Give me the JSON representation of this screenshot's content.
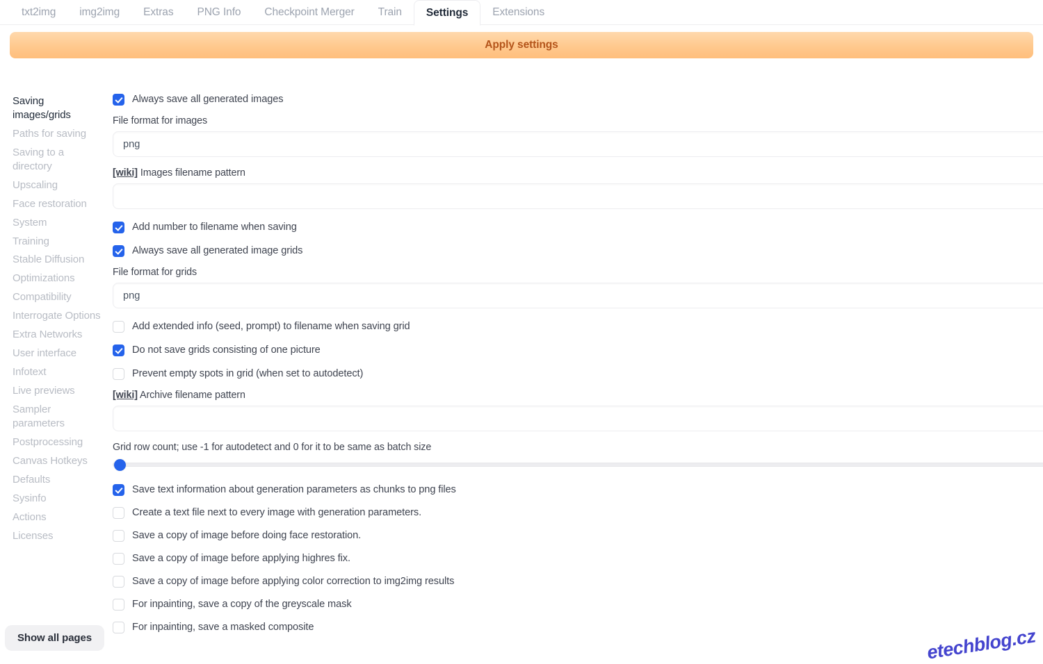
{
  "tabs": [
    {
      "label": "txt2img",
      "active": false
    },
    {
      "label": "img2img",
      "active": false
    },
    {
      "label": "Extras",
      "active": false
    },
    {
      "label": "PNG Info",
      "active": false
    },
    {
      "label": "Checkpoint Merger",
      "active": false
    },
    {
      "label": "Train",
      "active": false
    },
    {
      "label": "Settings",
      "active": true
    },
    {
      "label": "Extensions",
      "active": false
    }
  ],
  "toolbar": {
    "apply_label": "Apply settings",
    "apply_bg_start": "#ffd9ad",
    "apply_bg_end": "#ffbe7c",
    "apply_text_color": "#b4541a"
  },
  "sidebar": {
    "items": [
      {
        "label": "Saving images/grids",
        "active": true
      },
      {
        "label": "Paths for saving",
        "active": false
      },
      {
        "label": "Saving to a directory",
        "active": false
      },
      {
        "label": "Upscaling",
        "active": false
      },
      {
        "label": "Face restoration",
        "active": false
      },
      {
        "label": "System",
        "active": false
      },
      {
        "label": "Training",
        "active": false
      },
      {
        "label": "Stable Diffusion",
        "active": false
      },
      {
        "label": "Optimizations",
        "active": false
      },
      {
        "label": "Compatibility",
        "active": false
      },
      {
        "label": "Interrogate Options",
        "active": false
      },
      {
        "label": "Extra Networks",
        "active": false
      },
      {
        "label": "User interface",
        "active": false
      },
      {
        "label": "Infotext",
        "active": false
      },
      {
        "label": "Live previews",
        "active": false
      },
      {
        "label": "Sampler parameters",
        "active": false
      },
      {
        "label": "Postprocessing",
        "active": false
      },
      {
        "label": "Canvas Hotkeys",
        "active": false
      },
      {
        "label": "Defaults",
        "active": false
      },
      {
        "label": "Sysinfo",
        "active": false
      },
      {
        "label": "Actions",
        "active": false
      },
      {
        "label": "Licenses",
        "active": false
      }
    ],
    "show_all_label": "Show all pages"
  },
  "settings": {
    "check_always_save_images": "Always save all generated images",
    "label_file_format_images": "File format for images",
    "value_file_format_images": "png",
    "wiki_tag": "[wiki]",
    "label_images_filename_pattern": " Images filename pattern",
    "value_images_filename_pattern": "",
    "check_add_number": "Add number to filename when saving",
    "check_always_save_grids": "Always save all generated image grids",
    "label_file_format_grids": "File format for grids",
    "value_file_format_grids": "png",
    "check_add_extended_info": "Add extended info (seed, prompt) to filename when saving grid",
    "check_no_single_grids": "Do not save grids consisting of one picture",
    "check_prevent_empty_spots": "Prevent empty spots in grid (when set to autodetect)",
    "label_archive_filename_pattern": " Archive filename pattern",
    "value_archive_filename_pattern": "",
    "label_grid_row_count": "Grid row count; use -1 for autodetect and 0 for it to be same as batch size",
    "check_save_text_chunks": "Save text information about generation parameters as chunks to png files",
    "check_create_text_file": "Create a text file next to every image with generation parameters.",
    "check_save_before_face_restore": "Save a copy of image before doing face restoration.",
    "check_save_before_highres": "Save a copy of image before applying highres fix.",
    "check_save_before_color_correction": "Save a copy of image before applying color correction to img2img results",
    "check_inpaint_greyscale_mask": "For inpainting, save a copy of the greyscale mask",
    "check_inpaint_masked_composite": "For inpainting, save a masked composite"
  },
  "watermark": {
    "text": "etechblog.cz",
    "color": "#3b3bcc"
  }
}
